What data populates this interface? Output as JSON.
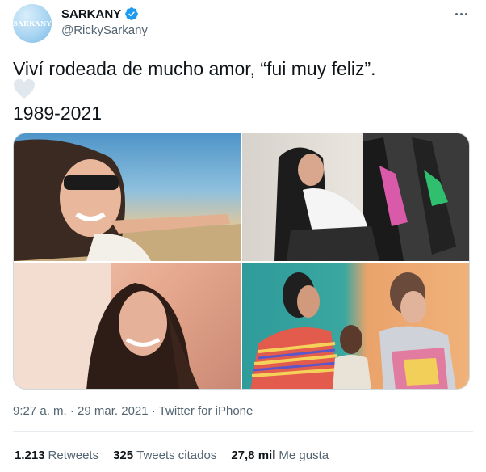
{
  "author": {
    "avatar_text": "SARKANY",
    "display_name": "SARKANY",
    "handle": "@RickySarkany"
  },
  "tweet": {
    "text": "Viví rodeada de mucho amor, “fui muy feliz”.",
    "years": "1989-2021"
  },
  "meta": {
    "timestamp": "9:27 a. m. · 29 mar. 2021 · Twitter for iPhone"
  },
  "stats": {
    "retweets_count": "1.213",
    "retweets_label": "Retweets",
    "quotes_count": "325",
    "quotes_label": "Tweets citados",
    "likes_count": "27,8 mil",
    "likes_label": "Me gusta"
  },
  "colors": {
    "verified": "#1d9bf0",
    "heart": "#e1e8ed",
    "secondary_text": "#536471"
  },
  "icons": {
    "verified": "verified-badge-icon",
    "heart": "white-heart-emoji",
    "more": "more-dots-icon"
  }
}
